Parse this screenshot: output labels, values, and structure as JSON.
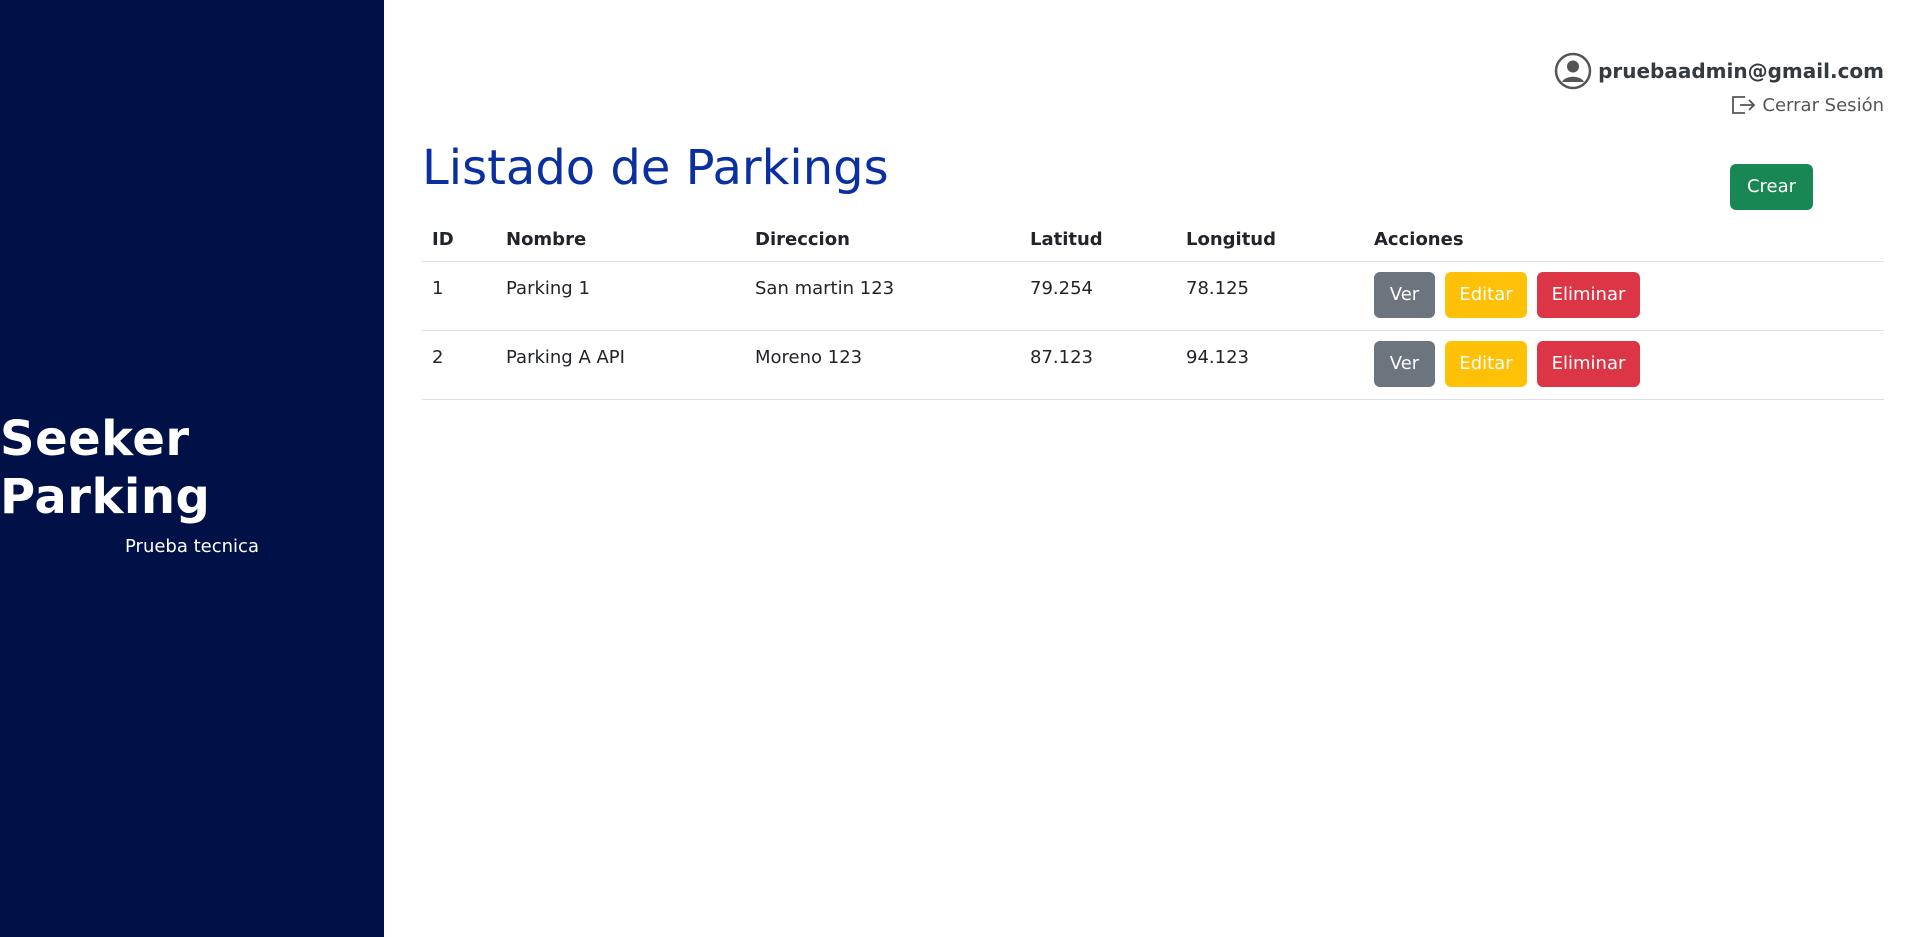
{
  "sidebar": {
    "title": "Seeker Parking",
    "subtitle": "Prueba tecnica",
    "background": "#001148"
  },
  "header": {
    "user_email": "pruebaadmin@gmail.com",
    "user_icon": "user-circle-icon",
    "logout_label": "Cerrar Sesión",
    "logout_icon": "logout-icon"
  },
  "main": {
    "title": "Listado de Parkings",
    "create_label": "Crear"
  },
  "table": {
    "headers": [
      "ID",
      "Nombre",
      "Direccion",
      "Latitud",
      "Longitud",
      "Acciones"
    ],
    "rows": [
      {
        "id": "1",
        "nombre": "Parking 1",
        "direccion": "San martin 123",
        "latitud": "79.254",
        "longitud": "78.125"
      },
      {
        "id": "2",
        "nombre": "Parking A API",
        "direccion": "Moreno 123",
        "latitud": "87.123",
        "longitud": "94.123"
      }
    ],
    "actions": {
      "view": "Ver",
      "edit": "Editar",
      "delete": "Eliminar"
    }
  },
  "colors": {
    "title": "#0a2fa0",
    "create": "#198754",
    "view": "#6c757d",
    "edit": "#ffc107",
    "delete": "#dc3545"
  }
}
